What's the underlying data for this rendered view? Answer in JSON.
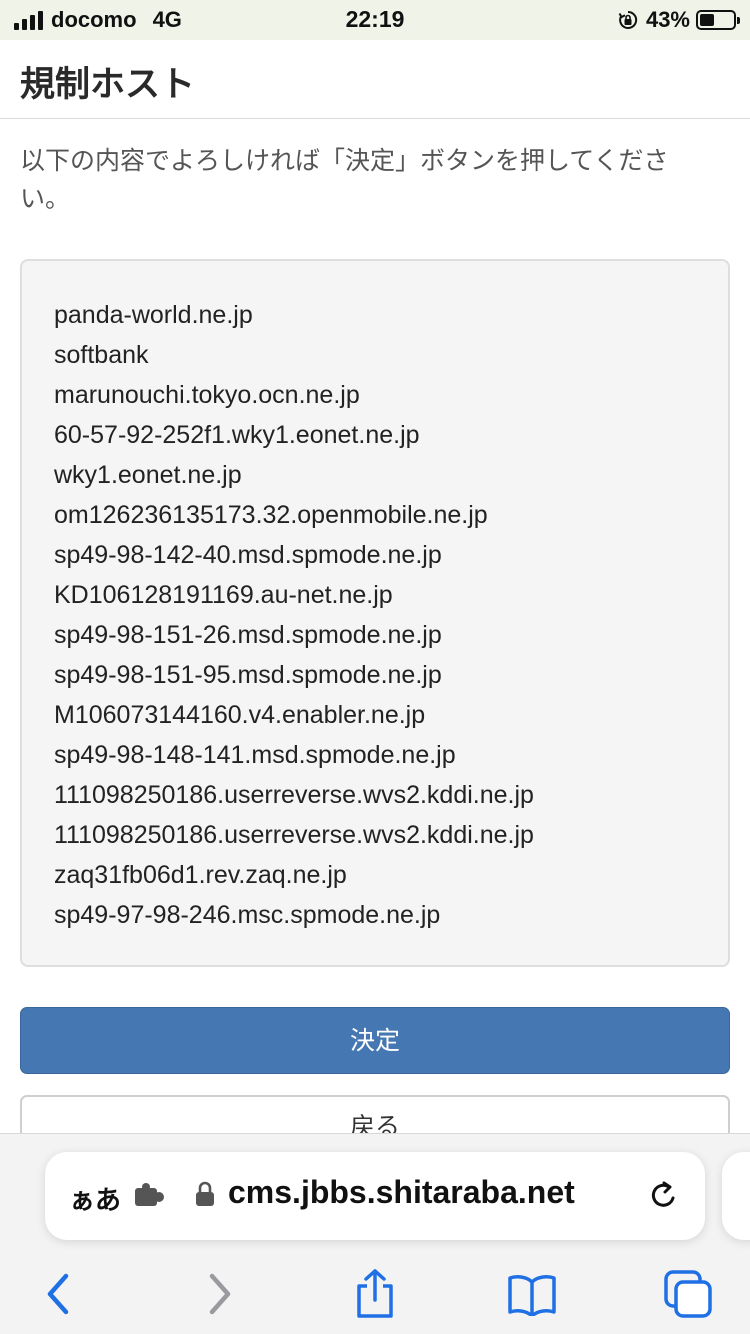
{
  "status_bar": {
    "carrier": "docomo",
    "network": "4G",
    "time": "22:19",
    "battery_percent": "43%",
    "battery_level": 0.43,
    "icons": [
      "signal-bars-icon",
      "rotation-lock-icon",
      "battery-icon"
    ]
  },
  "header": {
    "title": "規制ホスト"
  },
  "main": {
    "instruction": "以下の内容でよろしければ「決定」ボタンを押してください。",
    "hosts": [
      "panda-world.ne.jp",
      "softbank",
      "marunouchi.tokyo.ocn.ne.jp",
      "60-57-92-252f1.wky1.eonet.ne.jp",
      "wky1.eonet.ne.jp",
      "om126236135173.32.openmobile.ne.jp",
      "sp49-98-142-40.msd.spmode.ne.jp",
      "KD106128191169.au-net.ne.jp",
      "sp49-98-151-26.msd.spmode.ne.jp",
      "sp49-98-151-95.msd.spmode.ne.jp",
      "M106073144160.v4.enabler.ne.jp",
      "sp49-98-148-141.msd.spmode.ne.jp",
      "111098250186.userreverse.wvs2.kddi.ne.jp",
      "111098250186.userreverse.wvs2.kddi.ne.jp",
      "zaq31fb06d1.rev.zaq.ne.jp",
      "sp49-97-98-246.msc.spmode.ne.jp"
    ],
    "submit_label": "決定",
    "back_label": "戻る"
  },
  "browser": {
    "text_size_label": "ぁあ",
    "url": "cms.jbbs.shitaraba.net",
    "icons": [
      "extension-icon",
      "lock-icon",
      "reload-icon",
      "back-icon",
      "forward-icon",
      "share-icon",
      "bookmarks-icon",
      "tabs-icon"
    ]
  },
  "colors": {
    "accent": "#4577b2",
    "ios_blue": "#1f6fe5",
    "status_bar_bg": "#eff3e8"
  }
}
